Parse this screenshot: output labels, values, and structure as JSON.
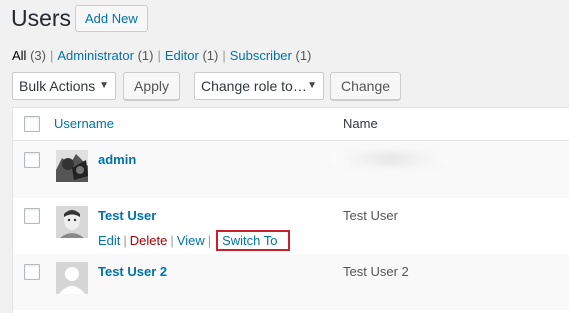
{
  "header": {
    "title": "Users",
    "add_new_label": "Add New"
  },
  "filters": [
    {
      "label": "All",
      "count": "(3)",
      "current": true
    },
    {
      "label": "Administrator",
      "count": "(1)",
      "current": false
    },
    {
      "label": "Editor",
      "count": "(1)",
      "current": false
    },
    {
      "label": "Subscriber",
      "count": "(1)",
      "current": false
    }
  ],
  "filter_separator": "|",
  "toolbar": {
    "bulk_actions_value": "Bulk Actions",
    "apply_label": "Apply",
    "change_role_value": "Change role to…",
    "change_label": "Change"
  },
  "table": {
    "columns": {
      "username": "Username",
      "name": "Name"
    },
    "rows": [
      {
        "username": "admin",
        "name": ""
      },
      {
        "username": "Test User",
        "name": "Test User",
        "actions": {
          "edit": "Edit",
          "delete": "Delete",
          "view": "View",
          "switch": "Switch To"
        }
      },
      {
        "username": "Test User 2",
        "name": "Test User 2"
      }
    ]
  },
  "colors": {
    "link": "#0073aa",
    "delete": "#a00000",
    "highlight_border": "#c9202b"
  },
  "icons": {
    "dropdown": "chevron-down-icon",
    "avatar_placeholder": "user-silhouette-icon"
  }
}
